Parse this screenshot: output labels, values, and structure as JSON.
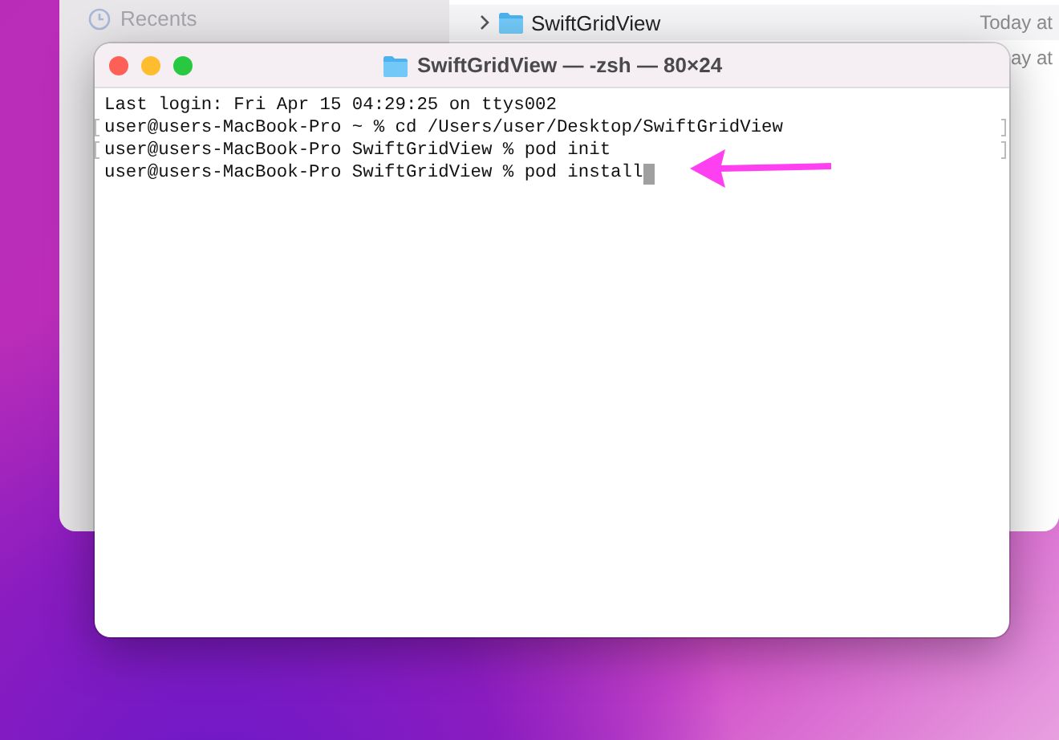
{
  "finder": {
    "sidebar": [
      {
        "label": "Recents"
      }
    ],
    "rows": [
      {
        "name": "SwiftGridView",
        "date": "Today at"
      },
      {
        "date": "ay at"
      }
    ]
  },
  "terminal": {
    "title": "SwiftGridView — -zsh — 80×24",
    "lines": [
      {
        "text": "Last login: Fri Apr 15 04:29:25 on ttys002",
        "marked": false
      },
      {
        "text": "user@users-MacBook-Pro ~ % cd /Users/user/Desktop/SwiftGridView",
        "marked": true
      },
      {
        "text": "user@users-MacBook-Pro SwiftGridView % pod init",
        "marked": true
      },
      {
        "text": "user@users-MacBook-Pro SwiftGridView % pod install",
        "marked": false,
        "cursor": true
      }
    ]
  }
}
